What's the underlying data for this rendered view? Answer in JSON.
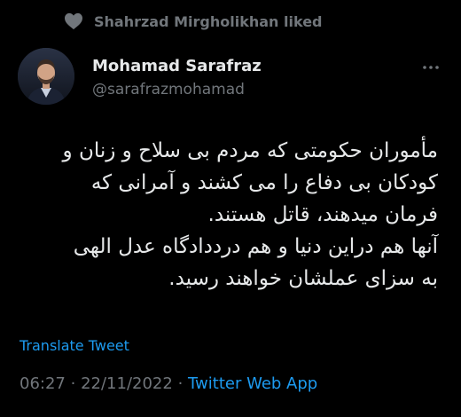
{
  "social_context": {
    "label": "Shahrzad Mirgholikhan liked"
  },
  "author": {
    "display_name": "Mohamad Sarafraz",
    "handle": "@sarafrazmohamad"
  },
  "tweet": {
    "lines": [
      "مأموران حکومتی که مردم بی سلاح و زنان و",
      "کودکان بی دفاع را می کشند و آمرانی که",
      "فرمان میدهند، قاتل هستند.",
      "آنها هم دراین دنیا و هم درددادگاه عدل الهی",
      "به سزای عملشان خواهند رسید."
    ],
    "translate_label": "Translate Tweet",
    "time": "06:27",
    "separator": "·",
    "date": "22/11/2022",
    "source": "Twitter Web App"
  },
  "colors": {
    "background": "#000000",
    "primary_text": "#e7e9ea",
    "secondary_text": "#71767b",
    "accent": "#1d9bf0"
  },
  "icons": {
    "social_context": "heart-icon",
    "menu": "more-icon"
  }
}
